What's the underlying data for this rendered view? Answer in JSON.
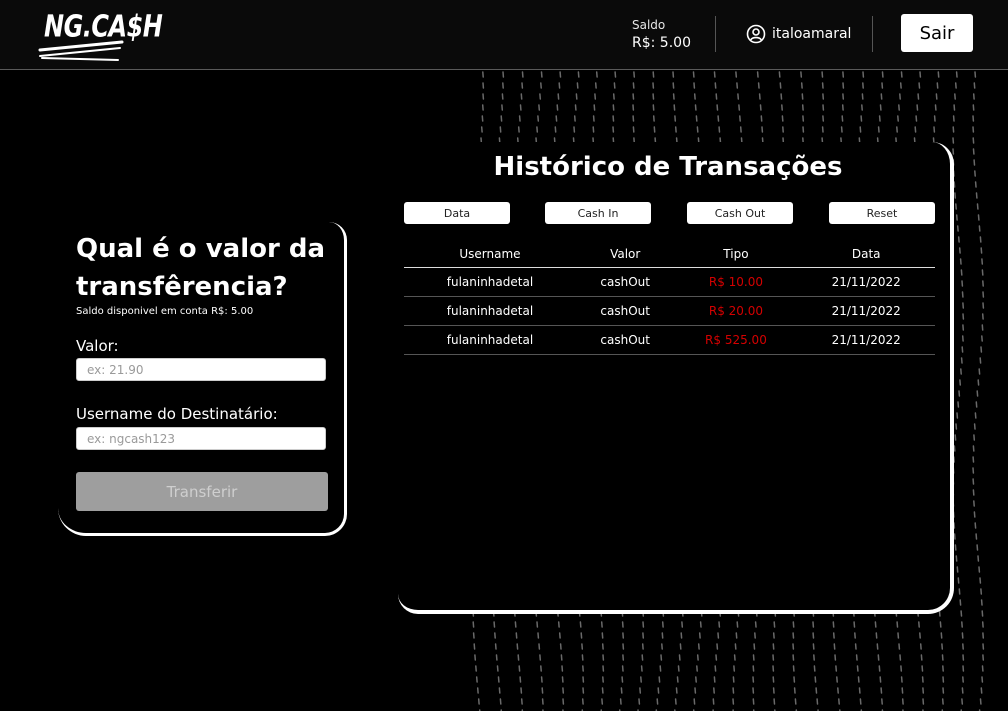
{
  "header": {
    "logo_text": "NG.CA$H",
    "balance_label": "Saldo",
    "balance_value": "R$: 5.00",
    "username": "italoamaral",
    "logout_label": "Sair"
  },
  "transfer": {
    "title": "Qual é o valor da transfêrencia?",
    "available_text": "Saldo disponivel em conta R$: 5.00",
    "value_label": "Valor:",
    "value_placeholder": "ex: 21.90",
    "value_input": "",
    "recipient_label": "Username do Destinatário:",
    "recipient_placeholder": "ex: ngcash123",
    "recipient_input": "",
    "submit_label": "Transferir"
  },
  "history": {
    "title": "Histórico de Transações",
    "filters": [
      "Data",
      "Cash In",
      "Cash Out",
      "Reset"
    ],
    "columns": [
      "Username",
      "Valor",
      "Tipo",
      "Data"
    ],
    "rows": [
      {
        "username": "fulaninhadetal",
        "type": "cashOut",
        "amount": "R$ 10.00",
        "date": "21/11/2022"
      },
      {
        "username": "fulaninhadetal",
        "type": "cashOut",
        "amount": "R$ 20.00",
        "date": "21/11/2022"
      },
      {
        "username": "fulaninhadetal",
        "type": "cashOut",
        "amount": "R$ 525.00",
        "date": "21/11/2022"
      }
    ]
  },
  "colors": {
    "background": "#000000",
    "cash_out": "#d40000",
    "disabled_button": "#9e9e9e"
  },
  "icons": {
    "user": "user-circle-icon"
  }
}
